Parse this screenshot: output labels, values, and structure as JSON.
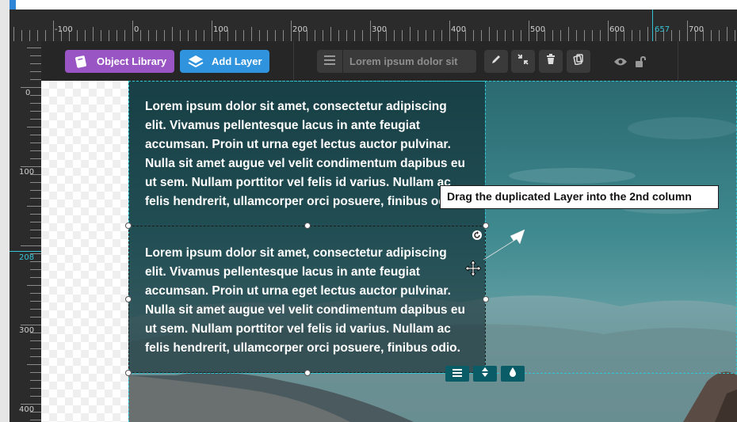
{
  "rulers": {
    "horizontal_labels": [
      "-100",
      "0",
      "100",
      "200",
      "300",
      "400",
      "500",
      "600",
      "657",
      "700"
    ],
    "vertical_labels": [
      "0",
      "100",
      "208",
      "300",
      "400"
    ],
    "horizontal_active": "657",
    "vertical_active": "208"
  },
  "toolbar": {
    "object_library_label": "Object Library",
    "add_layer_label": "Add Layer",
    "layer_name_value": "Lorem ipsum dolor sit",
    "object_library_color": "#9a55c4",
    "add_layer_color": "#2f93dd"
  },
  "canvas": {
    "text_layer_1": "Lorem ipsum dolor sit amet, consectetur adipiscing elit. Vivamus pellentesque lacus in ante feugiat accumsan. Proin ut urna eget lectus auctor pulvinar. Nulla sit amet augue vel velit condimentum dapibus eu ut sem. Nullam porttitor vel felis id varius. Nullam ac felis hendrerit, ullamcorper orci posuere, finibus odio.",
    "text_layer_2": "Lorem ipsum dolor sit amet, consectetur adipiscing elit. Vivamus pellentesque lacus in ante feugiat accumsan. Proin ut urna eget lectus auctor pulvinar. Nulla sit amet augue vel velit condimentum dapibus eu ut sem. Nullam porttitor vel felis id varius. Nullam ac felis hendrerit, ullamcorper orci posuere, finibus odio.",
    "tooltip": "Drag the duplicated Layer into the 2nd column",
    "guide_color": "#2ec7d6"
  }
}
